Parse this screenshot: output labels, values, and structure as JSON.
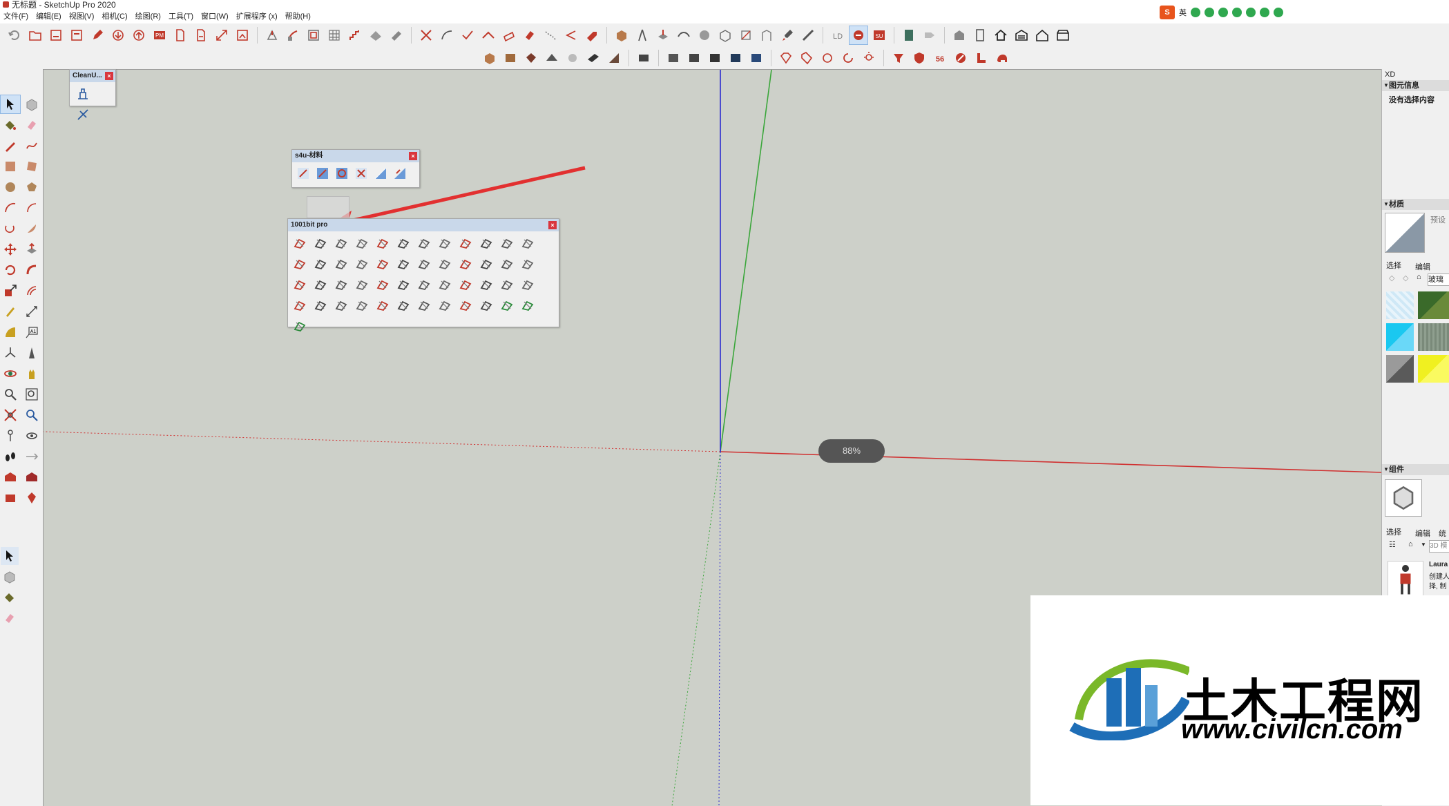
{
  "window": {
    "title": "无标题 - SketchUp Pro 2020"
  },
  "menu": [
    "文件(F)",
    "编辑(E)",
    "视图(V)",
    "相机(C)",
    "绘图(R)",
    "工具(T)",
    "窗口(W)",
    "扩展程序 (x)",
    "帮助(H)"
  ],
  "ime": {
    "logo": "S",
    "lang": "英"
  },
  "viewport": {
    "zoom_label": "88%"
  },
  "palettes": {
    "cleanup": {
      "title": "CleanU..."
    },
    "s4u": {
      "title": "s4u-材料"
    },
    "bit1001": {
      "title": "1001bit pro"
    }
  },
  "right_panel": {
    "header": "XD",
    "entity_info": {
      "title": "图元信息",
      "empty_text": "没有选择内容"
    },
    "materials": {
      "title": "材质",
      "preset": "预设",
      "select_tab": "选择",
      "edit_tab": "编辑",
      "field": "玻璃"
    },
    "components": {
      "title": "组件",
      "select_tab": "选择",
      "edit_tab": "编辑",
      "stats_tab": "统",
      "search": "3D 模",
      "item_name": "Laura",
      "item_desc": "创建人: Laura",
      "item_desc2": "择, 制"
    }
  },
  "watermark": {
    "name": "土木工程网",
    "url": "www.civilcn.com"
  },
  "colors": {
    "viewport_bg": "#cdd0c9",
    "axis_red": "#d03030",
    "axis_green": "#3aa63a",
    "axis_blue": "#2a2ad0",
    "arrow": "#e23030"
  }
}
